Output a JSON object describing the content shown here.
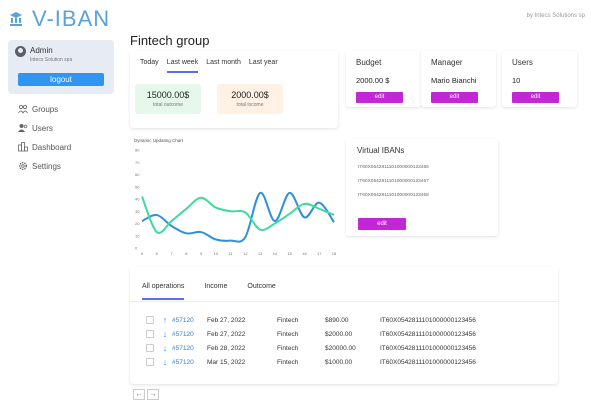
{
  "app": {
    "title": "V-IBAN",
    "byline": "by Intecs Solutions sp"
  },
  "user": {
    "name": "Admin",
    "company": "Intecs Solution spa",
    "logout_label": "logout"
  },
  "nav": [
    {
      "label": "Groups",
      "icon": "groups-icon"
    },
    {
      "label": "Users",
      "icon": "users-icon"
    },
    {
      "label": "Dashboard",
      "icon": "dashboard-icon"
    },
    {
      "label": "Settings",
      "icon": "gear-icon"
    }
  ],
  "page": {
    "title": "Fintech group"
  },
  "period_tabs": [
    "Today",
    "Last week",
    "Last month",
    "Last year"
  ],
  "active_period": "Last week",
  "stats": [
    {
      "value": "15000.00$",
      "label": "total outcome"
    },
    {
      "value": "2000.00$",
      "label": "total income"
    }
  ],
  "cards": {
    "budget": {
      "title": "Budget",
      "value": "2000.00 $",
      "button": "edit"
    },
    "manager": {
      "title": "Manager",
      "value": "Mario Bianchi",
      "button": "edit"
    },
    "users": {
      "title": "Users",
      "value": "10",
      "button": "edit"
    }
  },
  "viban": {
    "title": "Virtual IBANs",
    "items": [
      "IT60X0542811101000000123456",
      "IT60X0542811101000000123457",
      "IT60X0542811101000000123458"
    ],
    "button": "edit"
  },
  "operations": {
    "tabs": [
      "All operations",
      "Income",
      "Outcome"
    ],
    "rows": [
      {
        "dir": "up",
        "id": "#57120",
        "date": "Feb 27, 2022",
        "group": "Fintech",
        "amount": "$890.00",
        "iban": "IT60X0542811101000000123456"
      },
      {
        "dir": "down",
        "id": "#57120",
        "date": "Feb 27, 2022",
        "group": "Fintech",
        "amount": "$2000.00",
        "iban": "IT60X0542811101000000123456"
      },
      {
        "dir": "down",
        "id": "#57120",
        "date": "Feb 28, 2022",
        "group": "Fintech",
        "amount": "$20000.00",
        "iban": "IT60X0542811101000000123456"
      },
      {
        "dir": "down",
        "id": "#57120",
        "date": "Mar 15, 2022",
        "group": "Fintech",
        "amount": "$1000.00",
        "iban": "IT60X0542811101000000123456"
      }
    ]
  },
  "pager": {
    "prev": "←",
    "next": "→"
  },
  "chart_data": {
    "type": "line",
    "title": "Dynamic Updating Chart",
    "x": [
      5,
      6,
      7,
      8,
      9,
      10,
      11,
      12,
      13,
      14,
      15,
      16,
      17,
      18
    ],
    "ylim": [
      0,
      80
    ],
    "yticks": [
      0,
      10,
      20,
      30,
      40,
      50,
      60,
      70,
      80
    ],
    "series": [
      {
        "color": "#2f8fd9",
        "values": [
          22,
          27,
          18,
          12,
          13,
          7,
          6,
          9,
          45,
          22,
          45,
          25,
          37,
          21
        ]
      },
      {
        "color": "#3ddb9c",
        "values": [
          42,
          13,
          22,
          32,
          41,
          33,
          30,
          29,
          15,
          20,
          28,
          36,
          32,
          27
        ]
      }
    ]
  }
}
